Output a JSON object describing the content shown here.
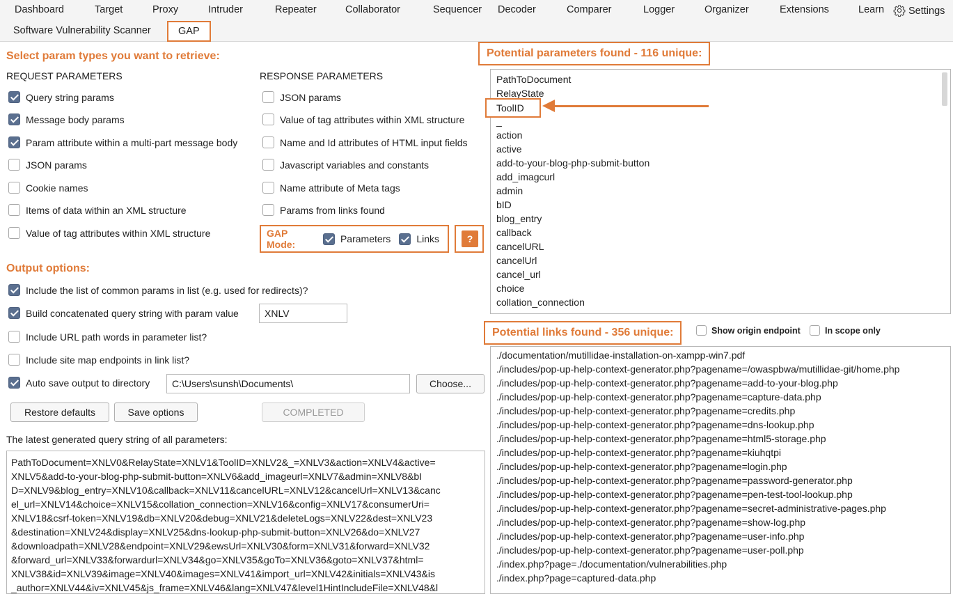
{
  "nav": {
    "tabs": [
      "Dashboard",
      "Target",
      "Proxy",
      "Intruder",
      "Repeater",
      "Collaborator",
      "Sequencer",
      "Decoder",
      "Comparer",
      "Logger",
      "Organizer",
      "Extensions",
      "Learn"
    ],
    "settings_label": "Settings",
    "settings_icon": "gear-icon"
  },
  "subnav": {
    "tabs": [
      "Software Vulnerability Scanner",
      "GAP"
    ],
    "active_tab": "GAP"
  },
  "left": {
    "heading": "Select param types you want to retrieve:",
    "request_heading": "REQUEST PARAMETERS",
    "response_heading": "RESPONSE PARAMETERS",
    "request_params": [
      {
        "label": "Query string params",
        "checked": true
      },
      {
        "label": "Message body params",
        "checked": true
      },
      {
        "label": "Param attribute within a multi-part message body",
        "checked": true
      },
      {
        "label": "JSON params",
        "checked": false
      },
      {
        "label": "Cookie names",
        "checked": false
      },
      {
        "label": "Items of data within an XML structure",
        "checked": false
      },
      {
        "label": "Value of tag attributes within XML structure",
        "checked": false
      }
    ],
    "response_params": [
      {
        "label": "JSON params",
        "checked": false
      },
      {
        "label": "Value of tag attributes within XML structure",
        "checked": false
      },
      {
        "label": "Name and Id attributes of HTML input fields",
        "checked": false
      },
      {
        "label": "Javascript variables and constants",
        "checked": false
      },
      {
        "label": "Name attribute of Meta tags",
        "checked": false
      },
      {
        "label": "Params from links found",
        "checked": false
      }
    ],
    "gap_mode": {
      "label": "GAP Mode:",
      "parameters_label": "Parameters",
      "parameters_checked": true,
      "links_label": "Links",
      "links_checked": true,
      "help_label": "?"
    },
    "output_heading": "Output options:",
    "output_options": [
      {
        "label": "Include the list of common params in list (e.g. used for redirects)?",
        "checked": true
      },
      {
        "label": "Build concatenated query string with param value",
        "checked": true
      },
      {
        "label": "Include URL path words in parameter list?",
        "checked": false
      },
      {
        "label": "Include site map endpoints in link list?",
        "checked": false
      },
      {
        "label": "Auto save output to directory",
        "checked": true
      }
    ],
    "param_value": "XNLV",
    "save_directory": "C:\\Users\\sunsh\\Documents\\",
    "choose_label": "Choose...",
    "restore_label": "Restore defaults",
    "save_options_label": "Save options",
    "status_label": "COMPLETED",
    "query_heading": "The latest generated query string of all parameters:",
    "query_lines": [
      "PathToDocument=XNLV0&RelayState=XNLV1&ToolID=XNLV2&_=XNLV3&action=XNLV4&active=",
      "XNLV5&add-to-your-blog-php-submit-button=XNLV6&add_imageurl=XNLV7&admin=XNLV8&bI",
      "D=XNLV9&blog_entry=XNLV10&callback=XNLV11&cancelURL=XNLV12&cancelUrl=XNLV13&canc",
      "el_url=XNLV14&choice=XNLV15&collation_connection=XNLV16&config=XNLV17&consumerUri=",
      "XNLV18&csrf-token=XNLV19&db=XNLV20&debug=XNLV21&deleteLogs=XNLV22&dest=XNLV23",
      "&destination=XNLV24&display=XNLV25&dns-lookup-php-submit-button=XNLV26&do=XNLV27",
      "&downloadpath=XNLV28&endpoint=XNLV29&ewsUrl=XNLV30&form=XNLV31&forward=XNLV32",
      "&forward_url=XNLV33&forwardurl=XNLV34&go=XNLV35&goTo=XNLV36&goto=XNLV37&html=",
      "XNLV38&id=XNLV39&image=XNLV40&images=XNLV41&import_url=XNLV42&initials=XNLV43&is",
      "_author=XNLV44&iv=XNLV45&js_frame=XNLV46&lang=XNLV47&level1HintIncludeFile=XNLV48&l"
    ]
  },
  "right": {
    "params_heading": "Potential parameters found - 116 unique:",
    "params": [
      "PathToDocument",
      "RelayState",
      "ToolID",
      "_",
      "action",
      "active",
      "add-to-your-blog-php-submit-button",
      "add_imagcurl",
      "admin",
      "bID",
      "blog_entry",
      "callback",
      "cancelURL",
      "cancelUrl",
      "cancel_url",
      "choice",
      "collation_connection"
    ],
    "links_heading": "Potential links found - 356 unique:",
    "show_origin_label": "Show origin endpoint",
    "in_scope_label": "In scope only",
    "links": [
      "./documentation/mutillidae-installation-on-xampp-win7.pdf",
      "./includes/pop-up-help-context-generator.php?pagename=/owaspbwa/mutillidae-git/home.php",
      "./includes/pop-up-help-context-generator.php?pagename=add-to-your-blog.php",
      "./includes/pop-up-help-context-generator.php?pagename=capture-data.php",
      "./includes/pop-up-help-context-generator.php?pagename=credits.php",
      "./includes/pop-up-help-context-generator.php?pagename=dns-lookup.php",
      "./includes/pop-up-help-context-generator.php?pagename=html5-storage.php",
      "./includes/pop-up-help-context-generator.php?pagename=kiuhqtpi",
      "./includes/pop-up-help-context-generator.php?pagename=login.php",
      "./includes/pop-up-help-context-generator.php?pagename=password-generator.php",
      "./includes/pop-up-help-context-generator.php?pagename=pen-test-tool-lookup.php",
      "./includes/pop-up-help-context-generator.php?pagename=secret-administrative-pages.php",
      "./includes/pop-up-help-context-generator.php?pagename=show-log.php",
      "./includes/pop-up-help-context-generator.php?pagename=user-info.php",
      "./includes/pop-up-help-context-generator.php?pagename=user-poll.php",
      "./index.php?page=./documentation/vulnerabilities.php",
      "./index.php?page=captured-data.php"
    ]
  },
  "colors": {
    "accent": "#e07b39",
    "checkbox_checked": "#5a6f8f"
  }
}
